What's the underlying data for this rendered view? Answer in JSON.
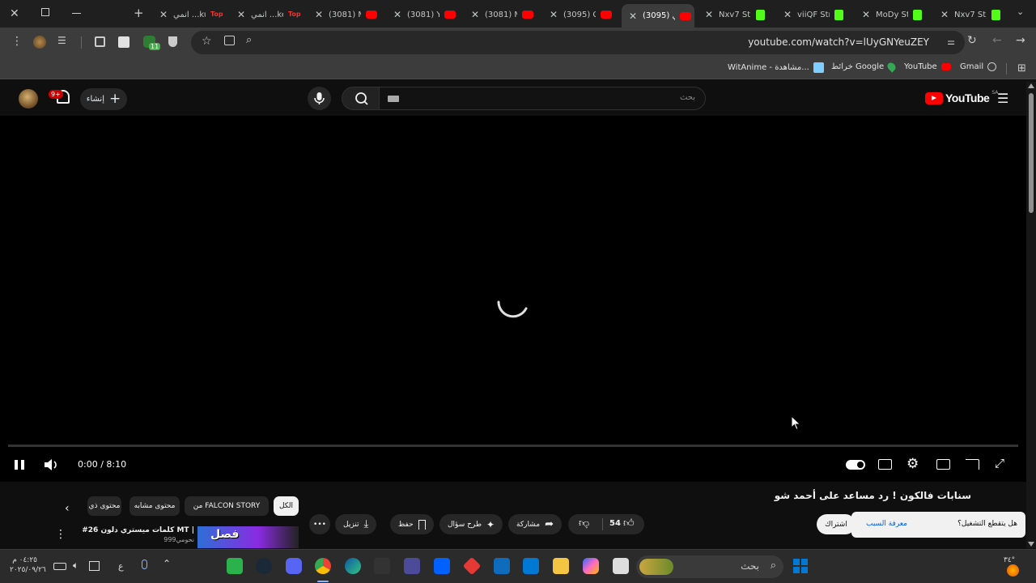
{
  "browser": {
    "tabs": [
      {
        "title": "انمي ...ku",
        "favicon": "top-icon"
      },
      {
        "title": "انمي ...ke",
        "favicon": "top-icon"
      },
      {
        "title": "(3081) M",
        "favicon": "youtube-icon"
      },
      {
        "title": "(3081) Y",
        "favicon": "youtube-icon"
      },
      {
        "title": "(3081) M",
        "favicon": "youtube-icon"
      },
      {
        "title": "(3095) C",
        "favicon": "youtube-icon"
      },
      {
        "title": "(3095) ي",
        "favicon": "youtube-icon",
        "active": true
      },
      {
        "title": "Nxv7 Str",
        "favicon": "kick-icon"
      },
      {
        "title": "viiQF Str",
        "favicon": "kick-icon"
      },
      {
        "title": "MoDy St",
        "favicon": "kick-icon"
      },
      {
        "title": "Nxv7 Str",
        "favicon": "kick-icon"
      }
    ],
    "url": "youtube.com/watch?v=lUyGNYeuZEY",
    "bookmarks": [
      {
        "label": "Gmail"
      },
      {
        "label": "YouTube"
      },
      {
        "label": "خرائط Google"
      },
      {
        "label": "WitAnime - مشاهدة..."
      }
    ],
    "extension_badge": "11"
  },
  "youtube": {
    "logo_text": "YouTube",
    "country_code": "SA",
    "search_placeholder": "بحث",
    "create_label": "إنشاء",
    "notification_count": "9+",
    "player": {
      "time": "0:00 / 8:10",
      "progress": 0,
      "state": "loading"
    },
    "video_title": "سنابات فالكون ! رد مساعد على أحمد شو",
    "subscribe_label": "اشتراك",
    "toast": {
      "question": "هل يتقطع التشغيل؟",
      "link": "معرفة السبب"
    },
    "actions": {
      "like_count": "54",
      "share": "مشاركة",
      "ask": "طرح سؤال",
      "save": "حفظ",
      "download": "تنزيل"
    },
    "chips": [
      {
        "label": "الكل",
        "selected": true
      },
      {
        "label": "من FALCON STORY",
        "selected": false
      },
      {
        "label": "محتوى مشابه",
        "selected": false
      },
      {
        "label": "محتوى ذي",
        "selected": false
      }
    ],
    "recommendation": {
      "title": "#26 كلمات ميستري دلون MT |",
      "channel": "نحومي999",
      "thumb_text": "فصل"
    }
  },
  "taskbar": {
    "search_placeholder": "بحث",
    "time": "٠٤:٢٥ م",
    "date": "٢٠٢٥/٠٩/٢٦",
    "lang": "ع",
    "weather": "٣٤°"
  },
  "colors": {
    "youtube_red": "#ff0000",
    "kick_green": "#53fc18",
    "accent_blue": "#3ea6ff",
    "windows_blue": "#0078d4"
  }
}
